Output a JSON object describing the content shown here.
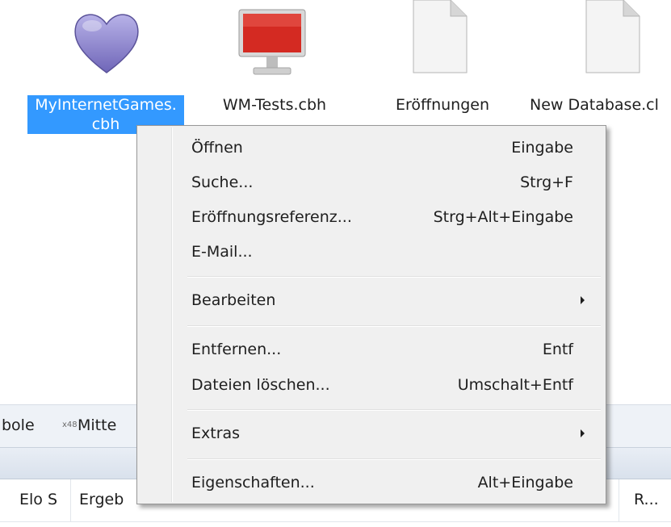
{
  "files": [
    {
      "name": "MyInternetGames.\ncbh",
      "line1": "MyInternetGames.",
      "line2": "cbh",
      "icon": "heart-database-icon",
      "selected": true
    },
    {
      "name": "WM-Tests.cbh",
      "icon": "monitor-database-icon"
    },
    {
      "name": "Eröffnungen",
      "icon": "blank-file-icon"
    },
    {
      "name": "New Database.cl",
      "icon": "blank-file-icon"
    }
  ],
  "tabbar": {
    "text_left": "bole",
    "badge": "x48",
    "text_right": "Mitte"
  },
  "columns": {
    "elo": "Elo S",
    "result": "Ergeb",
    "round": "R..."
  },
  "colors": {
    "selection": "#3399ff",
    "menu_bg": "#f0f0f0"
  },
  "context_menu": {
    "items": [
      {
        "label": "Öffnen",
        "shortcut": "Eingabe"
      },
      {
        "label": "Suche...",
        "shortcut": "Strg+F"
      },
      {
        "label": "Eröffnungsreferenz...",
        "shortcut": "Strg+Alt+Eingabe"
      },
      {
        "label": "E-Mail...",
        "shortcut": ""
      },
      {
        "label": "Bearbeiten",
        "submenu": true
      },
      {
        "label": "Entfernen...",
        "shortcut": "Entf"
      },
      {
        "label": "Dateien löschen...",
        "shortcut": "Umschalt+Entf"
      },
      {
        "label": "Extras",
        "submenu": true
      },
      {
        "label": "Eigenschaften...",
        "shortcut": "Alt+Eingabe"
      }
    ]
  }
}
